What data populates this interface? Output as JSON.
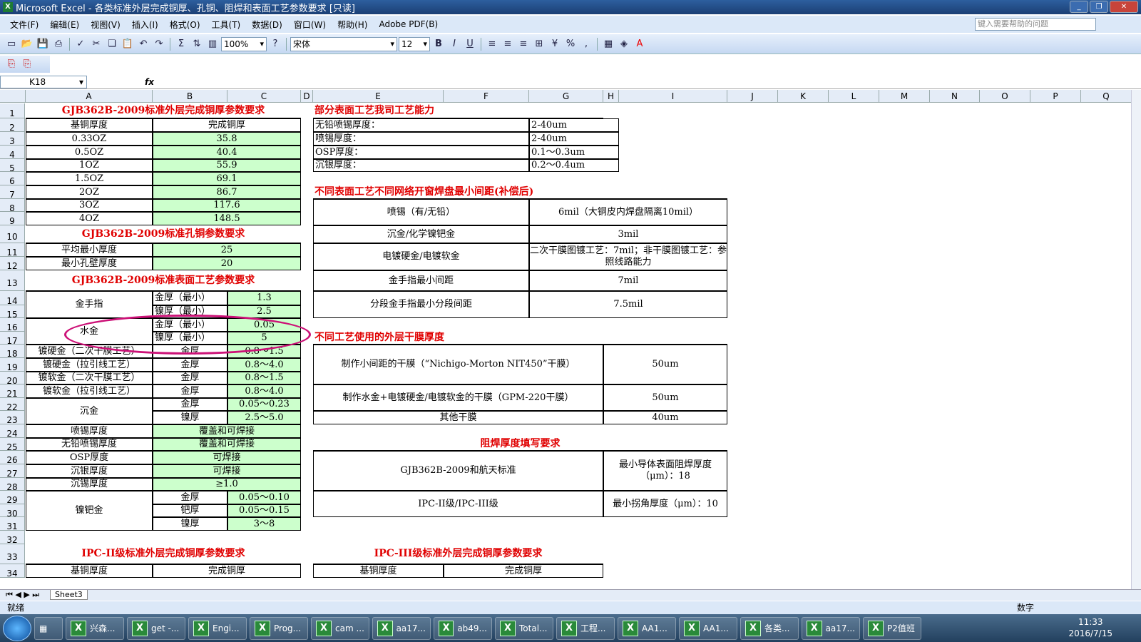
{
  "window": {
    "title": "Microsoft Excel - 各类标准外层完成铜厚、孔铜、阻焊和表面工艺参数要求  [只读]"
  },
  "menu": [
    "文件(F)",
    "编辑(E)",
    "视图(V)",
    "插入(I)",
    "格式(O)",
    "工具(T)",
    "数据(D)",
    "窗口(W)",
    "帮助(H)",
    "Adobe PDF(B)"
  ],
  "help_placeholder": "键入需要帮助的问题",
  "toolbar": {
    "zoom": "100%",
    "font": "宋体",
    "size": "12"
  },
  "formula": {
    "namebox": "K18",
    "fx": "fx"
  },
  "columns": [
    "A",
    "B",
    "C",
    "D",
    "E",
    "F",
    "G",
    "H",
    "I",
    "J",
    "K",
    "L",
    "M",
    "N",
    "O",
    "P",
    "Q"
  ],
  "rows": [
    "1",
    "2",
    "3",
    "4",
    "5",
    "6",
    "7",
    "8",
    "9",
    "10",
    "11",
    "12",
    "13",
    "14",
    "15",
    "16",
    "17",
    "18",
    "19",
    "20",
    "21",
    "22",
    "23",
    "24",
    "25",
    "26",
    "27",
    "28",
    "29",
    "30",
    "31",
    "32",
    "33",
    "34"
  ],
  "cells": {
    "a1": "GJB362B-2009标准外层完成铜厚参数要求",
    "a2": "基铜厚度",
    "b2": "完成铜厚",
    "base": [
      "0.33OZ",
      "0.5OZ",
      "1OZ",
      "1.5OZ",
      "2OZ",
      "3OZ",
      "4OZ"
    ],
    "fin": [
      "35.8",
      "40.4",
      "55.9",
      "69.1",
      "86.7",
      "117.6",
      "148.5"
    ],
    "a10": "GJB362B-2009标准孔铜参数要求",
    "a11": "平均最小厚度",
    "b11": "25",
    "a12": "最小孔壁厚度",
    "b12": "20",
    "a13": "GJB362B-2009标准表面工艺参数要求",
    "jsz": "金手指",
    "jhzx": "金厚（最小）",
    "nhzx": "镍厚（最小）",
    "v14": "1.3",
    "v15": "2.5",
    "sj": "水金",
    "v16": "0.05",
    "v17": "5",
    "r18": "镀硬金（二次干膜工艺）",
    "r19": "镀硬金（拉引线工艺）",
    "r20": "镀软金（二次干膜工艺）",
    "r21": "镀软金（拉引线工艺）",
    "jh": "金厚",
    "nh": "镍厚",
    "bh": "钯厚",
    "v18": "0.8～1.5",
    "v19": "0.8～4.0",
    "v20": "0.8～1.5",
    "v21": "0.8～4.0",
    "cj": "沉金",
    "v22": "0.05～0.23",
    "v23": "2.5～5.0",
    "r24": "喷锡厚度",
    "v24": "覆盖和可焊接",
    "r25": "无铅喷锡厚度",
    "v25": "覆盖和可焊接",
    "r26": "OSP厚度",
    "v26": "可焊接",
    "r27": "沉银厚度",
    "v27": "可焊接",
    "r28": "沉锡厚度",
    "v28": "≥1.0",
    "npj": "镍钯金",
    "v29": "0.05～0.10",
    "v30": "0.05～0.15",
    "v31": "3～8",
    "a33": "IPC-II级标准外层完成铜厚参数要求",
    "a34": "基铜厚度",
    "b34": "完成铜厚",
    "e33": "IPC-III级标准外层完成铜厚参数要求",
    "e34": "基铜厚度",
    "f34": "完成铜厚",
    "e1": "部分表面工艺我司工艺能力",
    "e2": "无铅喷锡厚度：",
    "g2": "2-40um",
    "e3": "喷锡厚度：",
    "g3": "2-40um",
    "e4": "OSP厚度：",
    "g4": "0.1～0.3um",
    "e5": "沉银厚度：",
    "g5": "0.2～0.4um",
    "e7": "不同表面工艺不同网络开窗焊盘最小间距(补偿后)",
    "e8": "喷锡（有/无铅）",
    "g8": "6mil（大铜皮内焊盘隔离10mil）",
    "e10": "沉金/化学镍钯金",
    "g10": "3mil",
    "e11": "电镀硬金/电镀软金",
    "g11": "二次干膜图镀工艺：7mil；非干膜图镀工艺：参照线路能力",
    "e13": "金手指最小间距",
    "g13": "7mil",
    "e14": "分段金手指最小分段间距",
    "g14": "7.5mil",
    "e17": "不同工艺使用的外层干膜厚度",
    "e18": "制作小间距的干膜（“Nichigo-Morton NIT450”干膜）",
    "i18": "50um",
    "e21": "制作水金+电镀硬金/电镀软金的干膜（GPM-220干膜）",
    "i21": "50um",
    "e23": "其他干膜",
    "i23": "40um",
    "e25": "阻焊厚度填写要求",
    "e26": "GJB362B-2009和航天标准",
    "i26": "最小导体表面阻焊厚度（μm）：18",
    "e29": "IPC-II级/IPC-III级",
    "i29": "最小拐角厚度（μm）：10"
  },
  "sheet_tab": "Sheet3",
  "status": {
    "left": "就绪",
    "right": "数字"
  },
  "taskbar": [
    "兴森...",
    "get -...",
    "Engi...",
    "Prog...",
    "cam ...",
    "aa17...",
    "ab49...",
    "Total...",
    "工程...",
    "AA1...",
    "AA1...",
    "各类...",
    "aa17...",
    "P2值班"
  ],
  "clock": {
    "time": "11:33",
    "date": "2016/7/15"
  },
  "colors": {
    "header_red": "#e00000",
    "green_fill": "#ccffcc",
    "annotation": "#cc1177"
  }
}
